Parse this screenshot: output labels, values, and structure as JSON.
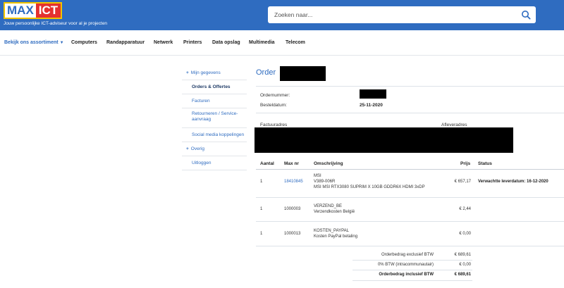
{
  "header": {
    "logo_max": "MAX",
    "logo_ict": "ICT",
    "tagline": "Jouw persoonlijke ICT-adviseur voor al je projecten",
    "search_placeholder": "Zoeken naar..."
  },
  "nav": {
    "items": [
      "Bekijk ons assortiment",
      "Computers",
      "Randapparatuur",
      "Netwerk",
      "Printers",
      "Data opslag",
      "Multimedia",
      "Telecom"
    ]
  },
  "sidebar": {
    "items": [
      "Mijn gegevens",
      "Orders & Offertes",
      "Facturen",
      "Retourneren / Service-aanvraag",
      "Social media koppelingen",
      "Overig",
      "Uitloggen"
    ]
  },
  "order": {
    "title": "Order",
    "ordernummer_label": "Ordernummer:",
    "besteldatum_label": "Besteldatum:",
    "besteldatum": "25-11-2020",
    "factuuradres_label": "Factuuradres",
    "afleveradres_label": "Afleveradres"
  },
  "table": {
    "headers": [
      "Aantal",
      "Max nr",
      "Omschrijving",
      "Prijs",
      "Status"
    ],
    "rows": [
      {
        "aantal": "1",
        "maxnr": "18410845",
        "desc1": "MSI",
        "desc2": "V389-006R",
        "desc3": "MSI MSI RTX3080 SUPRIM X 10GB GDDR6X HDMI 3xDP",
        "prijs": "€ 657,17",
        "status": "Verwachtte leverdatum:  16-12-2020"
      },
      {
        "aantal": "1",
        "maxnr": "1000003",
        "desc1": "VERZEND_BE",
        "desc2": "Verzendkosten België",
        "desc3": "",
        "prijs": "€ 2,44",
        "status": ""
      },
      {
        "aantal": "1",
        "maxnr": "1000013",
        "desc1": "KOSTEN_PAYPAL",
        "desc2": "Kosten PayPal betaling",
        "desc3": "",
        "prijs": "€ 0,00",
        "status": ""
      }
    ]
  },
  "totals": {
    "excl_label": "Orderbedrag exclusief BTW",
    "excl_value": "€ 689,61",
    "btw_label": "0% BTW (intracommunautair)",
    "btw_value": "€ 0,00",
    "incl_label": "Orderbedrag inclusief BTW",
    "incl_value": "€ 689,61"
  },
  "colors": {
    "brand_blue": "#2f6cc0",
    "logo_red": "#e4312f",
    "logo_yellow": "#f1c400"
  }
}
